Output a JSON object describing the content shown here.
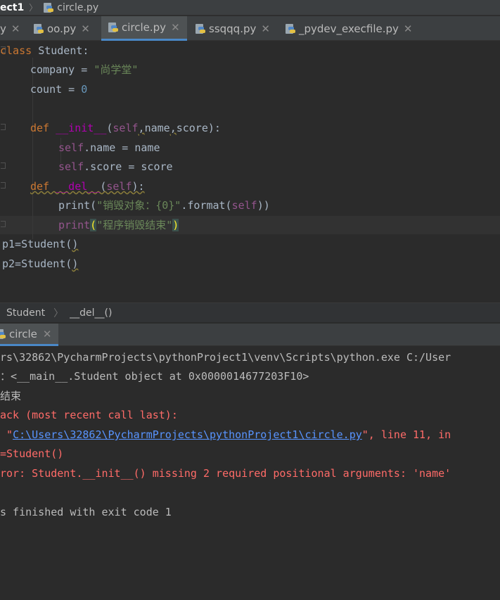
{
  "breadcrumb": {
    "project": "ect1",
    "file": "circle.py"
  },
  "tabs": [
    {
      "label": "y",
      "active": false
    },
    {
      "label": "oo.py",
      "active": false
    },
    {
      "label": "circle.py",
      "active": true
    },
    {
      "label": "ssqqq.py",
      "active": false
    },
    {
      "label": "_pydev_execfile.py",
      "active": false
    }
  ],
  "code": {
    "l1_kw": "class ",
    "l1_name": "Student:",
    "l2_ident": "company = ",
    "l2_str": "\"尚学堂\"",
    "l3_ident": "count = ",
    "l3_num": "0",
    "l5_kw": "def ",
    "l5_magic": "__init__",
    "l5_open": "(",
    "l5_self": "self",
    "l5_comma1": ",",
    "l5_name": "name",
    "l5_comma2": ",",
    "l5_rest": "score):",
    "l6_self": "self",
    "l6_rest": ".name = name",
    "l7_self": "self",
    "l7_rest": ".score = score",
    "l8_kw": "def ",
    "l8_magic": "__del__",
    "l8_open": "(",
    "l8_self": "self",
    "l8_close": "):",
    "l9_print": "print(",
    "l9_str": "\"销毁对象：{0}\"",
    "l9_fmt": ".format(",
    "l9_self": "self",
    "l9_close": "))",
    "l10_print": "print",
    "l10_open": "(",
    "l10_str": "\"程序销毁结束\"",
    "l10_close": ")",
    "l11_text": "p1=Student(",
    "l11_close": ")",
    "l12_text": "p2=Student(",
    "l12_close": ")"
  },
  "editor_breadcrumb": {
    "class_name": "Student",
    "sep": "〉",
    "method": "__del__()"
  },
  "run": {
    "tab_label": "circle"
  },
  "console": {
    "line1": "rs\\32862\\PycharmProjects\\pythonProject1\\venv\\Scripts\\python.exe C:/User",
    "line2": "：<__main__.Student object at 0x0000014677203F10>",
    "line3": "结束",
    "line4": "ack (most recent call last):",
    "line5_pre": " \"",
    "line5_link": "C:\\Users\\32862\\PycharmProjects\\pythonProject1\\circle.py",
    "line5_post": "\", line 11, in",
    "line6": "=Student()",
    "line7": "ror: Student.__init__() missing 2 required positional arguments: 'name'",
    "line8": "s finished with exit code 1"
  },
  "colors": {
    "background": "#2b2b2b",
    "keyword": "#cc7832",
    "string": "#6a8759",
    "number": "#6897bb",
    "self": "#94558d",
    "magic": "#b200b2",
    "error": "#ff6b68",
    "link": "#5894ff",
    "accent": "#4a88c7"
  }
}
